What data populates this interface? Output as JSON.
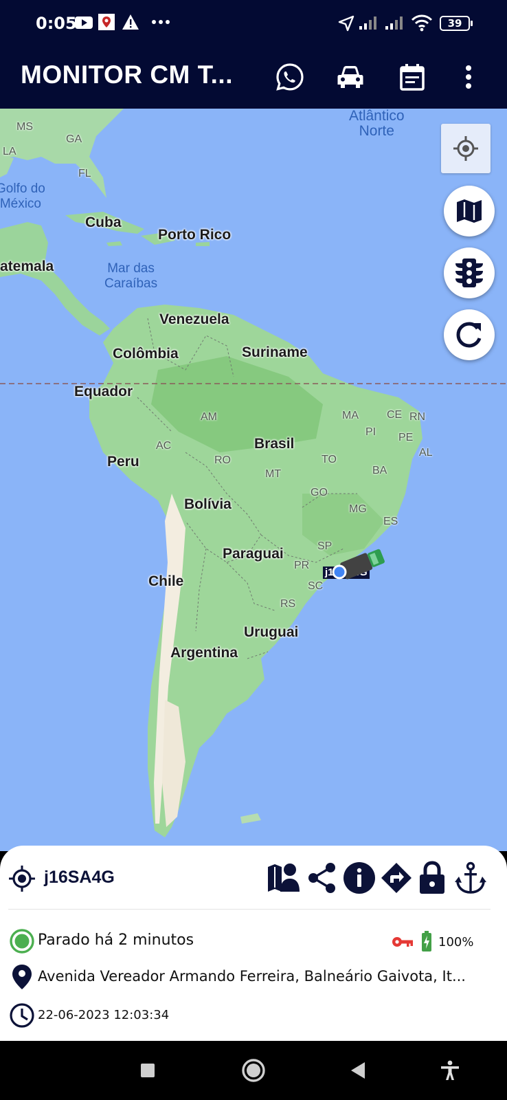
{
  "status_bar": {
    "time": "0:05",
    "battery": "39",
    "icons": [
      "youtube-icon",
      "location-app-icon",
      "warning-icon",
      "more-dots-icon",
      "navigation-arrow-icon",
      "signal-icon",
      "signal-icon",
      "wifi-icon",
      "battery-icon"
    ]
  },
  "app_bar": {
    "title": "MONITOR CM T...",
    "actions": [
      "whatsapp-icon",
      "car-icon",
      "calendar-icon",
      "overflow-menu-icon"
    ]
  },
  "map": {
    "water_labels": {
      "atlantico": "Atlântico\nNorte",
      "golfo": "Golfo do\nMéxico",
      "caraibas": "Mar das\nCaraíbas"
    },
    "countries": {
      "cuba": "Cuba",
      "porto_rico": "Porto Rico",
      "guatemala": "atemala",
      "venezuela": "Venezuela",
      "colombia": "Colômbia",
      "suriname": "Suriname",
      "equador": "Equador",
      "brasil": "Brasil",
      "peru": "Peru",
      "bolivia": "Bolívia",
      "paraguai": "Paraguai",
      "chile": "Chile",
      "uruguai": "Uruguai",
      "argentina": "Argentina"
    },
    "states": {
      "ms": "MS",
      "ga": "GA",
      "la": "LA",
      "fl": "FL",
      "am": "AM",
      "ac": "AC",
      "ro": "RO",
      "mt": "MT",
      "ma": "MA",
      "ce": "CE",
      "rn": "RN",
      "pi": "PI",
      "pe": "PE",
      "al": "AL",
      "to": "TO",
      "ba": "BA",
      "go": "GO",
      "mg": "MG",
      "es": "ES",
      "sp": "SP",
      "pr": "PR",
      "sc": "SC",
      "rs": "RS"
    },
    "vehicle_label": "j16SA4G",
    "controls": [
      "my-location-icon",
      "map-type-icon",
      "traffic-icon",
      "refresh-icon"
    ]
  },
  "sheet": {
    "vehicle_name": "j16SA4G",
    "actions": [
      "person-map-icon",
      "share-icon",
      "info-icon",
      "directions-icon",
      "lock-icon",
      "anchor-icon"
    ],
    "status_text": "Parado há 2 minutos",
    "battery_percent": "100%",
    "address": "Avenida Vereador Armando Ferreira, Balneário Gaivota, It...",
    "datetime": "22-06-2023 12:03:34",
    "colors": {
      "navy": "#0c1238",
      "stopped_green": "#4caf50",
      "key_red": "#e53935",
      "battery_green": "#43a047"
    }
  },
  "nav_bar": [
    "recents-icon",
    "home-icon",
    "back-icon",
    "accessibility-icon"
  ]
}
